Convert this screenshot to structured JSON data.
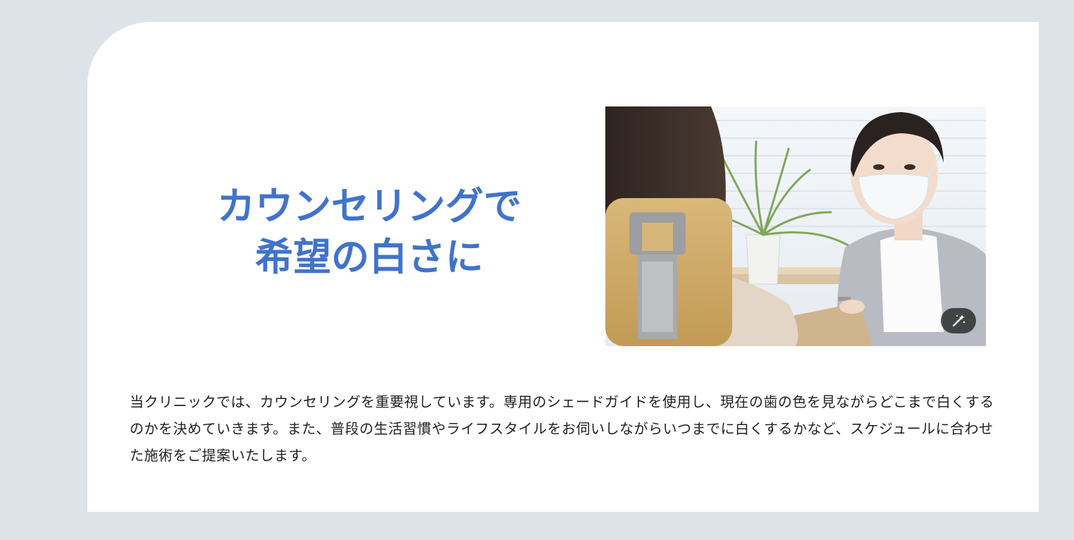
{
  "section": {
    "heading_line1": "カウンセリングで",
    "heading_line2": "希望の白さに",
    "body": "当クリニックでは、カウンセリングを重要視しています。専用のシェードガイドを使用し、現在の歯の色を見ながらどこまで白くするのかを決めていきます。また、普段の生活習慣やライフスタイルをお伺いしながらいつまでに白くするかなど、スケジュールに合わせた施術をご提案いたします。"
  },
  "image": {
    "icon": "magic-wand-icon"
  },
  "colors": {
    "page_background": "#dee3ea",
    "card_background": "#ffffff",
    "heading": "#4173cc",
    "body_text": "#222222"
  }
}
